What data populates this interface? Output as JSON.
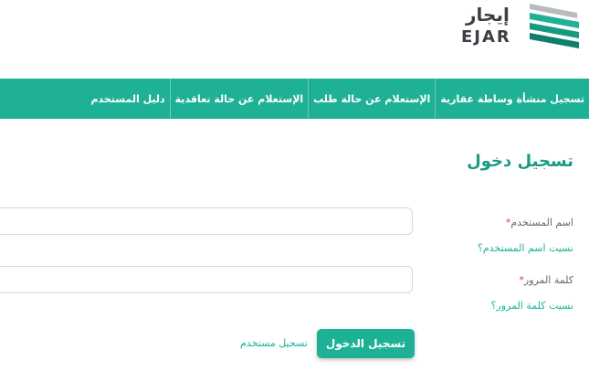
{
  "logo": {
    "arabic": "إيجار",
    "latin": "EJAR"
  },
  "nav": {
    "items": [
      {
        "label": "تسجيل منشأة وساطة عقارية"
      },
      {
        "label": "الإستعلام عن حالة طلب"
      },
      {
        "label": "الإستعلام عن حالة تعاقدية"
      },
      {
        "label": "دليل المستخدم"
      }
    ]
  },
  "login": {
    "title": "تسجيل دخول",
    "username_label": "اسم المستخدم",
    "username_value": "",
    "forgot_username": "نسيت اسم المستخدم؟",
    "password_label": "كلمة المرور",
    "password_value": "",
    "forgot_password": "نسيت كلمة المرور؟",
    "submit_label": "تسجيل الدخول",
    "register_label": "تسجيل مستخدم",
    "required_mark": "*"
  },
  "colors": {
    "accent": "#1eb196",
    "title": "#1a9a85",
    "required": "#e53935"
  }
}
